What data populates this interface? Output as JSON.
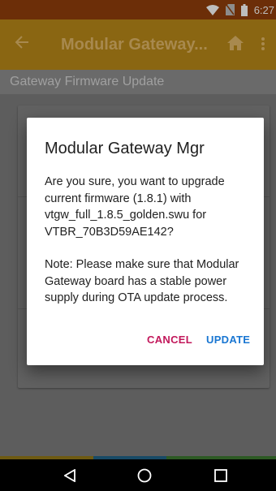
{
  "status_bar": {
    "time": "6:27",
    "icons": [
      "wifi-icon",
      "no-sim-icon",
      "battery-icon"
    ]
  },
  "app_bar": {
    "title": "Modular Gateway...",
    "back_icon": "arrow-left-icon",
    "home_icon": "home-icon",
    "more_icon": "more-vert-icon"
  },
  "page": {
    "subheader": "Gateway Firmware Update"
  },
  "dialog": {
    "title": "Modular Gateway Mgr",
    "message": "Are you sure, you want to upgrade current firmware (1.8.1) with vtgw_full_1.8.5_golden.swu for VTBR_70B3D59AE142?",
    "note": "Note: Please make sure that Modular Gateway board has a stable power supply during OTA update process.",
    "cancel_label": "CANCEL",
    "update_label": "UPDATE"
  },
  "nav_bar": {
    "icons": [
      "back-triangle-icon",
      "home-circle-icon",
      "recents-square-icon"
    ]
  },
  "colors": {
    "dialog_cancel": "#c2185b",
    "dialog_update": "#1976d2",
    "app_bar_dimmed": "#8a6612",
    "status_bar_dimmed": "#6c2e08"
  }
}
